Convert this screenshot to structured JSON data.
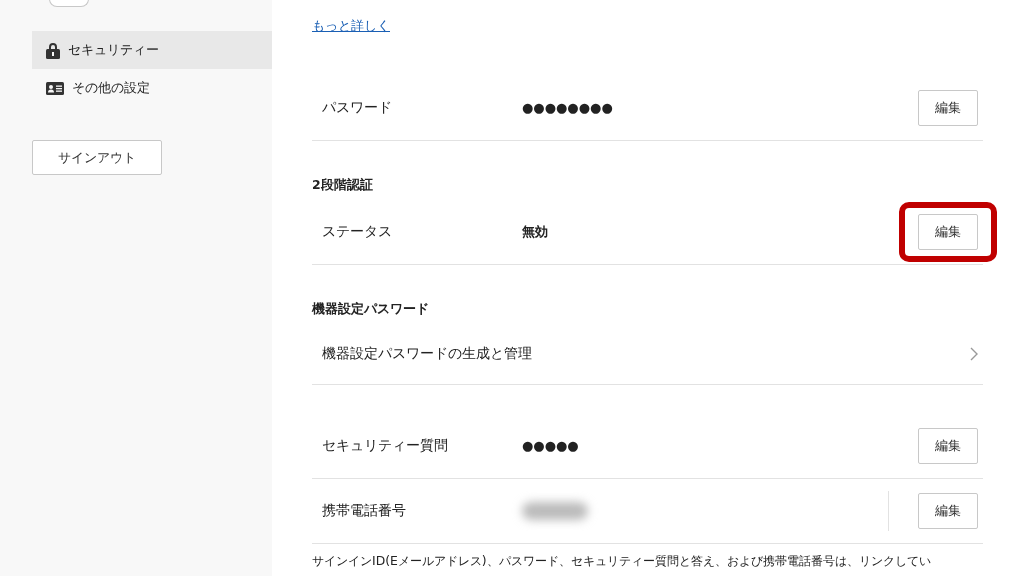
{
  "sidebar": {
    "items": [
      {
        "label": "セキュリティー",
        "kind": "lock",
        "selected": true
      },
      {
        "label": "その他の設定",
        "kind": "card",
        "selected": false
      }
    ],
    "sign_out": "サインアウト"
  },
  "main": {
    "items": [
      {
        "kind": "link",
        "text": "もっと詳しく"
      },
      {
        "kind": "field",
        "label": "パスワード",
        "value": "●●●●●●●●",
        "button": "編集",
        "highlighted": false
      },
      {
        "kind": "heading",
        "text": "2段階認証"
      },
      {
        "kind": "field",
        "label": "ステータス",
        "value": "無効",
        "bold": true,
        "button": "編集",
        "highlighted": true
      },
      {
        "kind": "heading",
        "text": "機器設定パスワード"
      },
      {
        "kind": "nav",
        "label": "機器設定パスワードの生成と管理"
      },
      {
        "kind": "field",
        "label": "セキュリティー質問",
        "value": "●●●●●",
        "button": "編集",
        "highlighted": false
      },
      {
        "kind": "field",
        "label": "携帯電話番号",
        "redacted": true,
        "divider": true,
        "button": "編集",
        "highlighted": false
      },
      {
        "kind": "note",
        "text": "サインインID(Eメールアドレス)、パスワード、セキュリティー質問と答え、および携帯電話番号は、リンクしてい"
      }
    ]
  }
}
